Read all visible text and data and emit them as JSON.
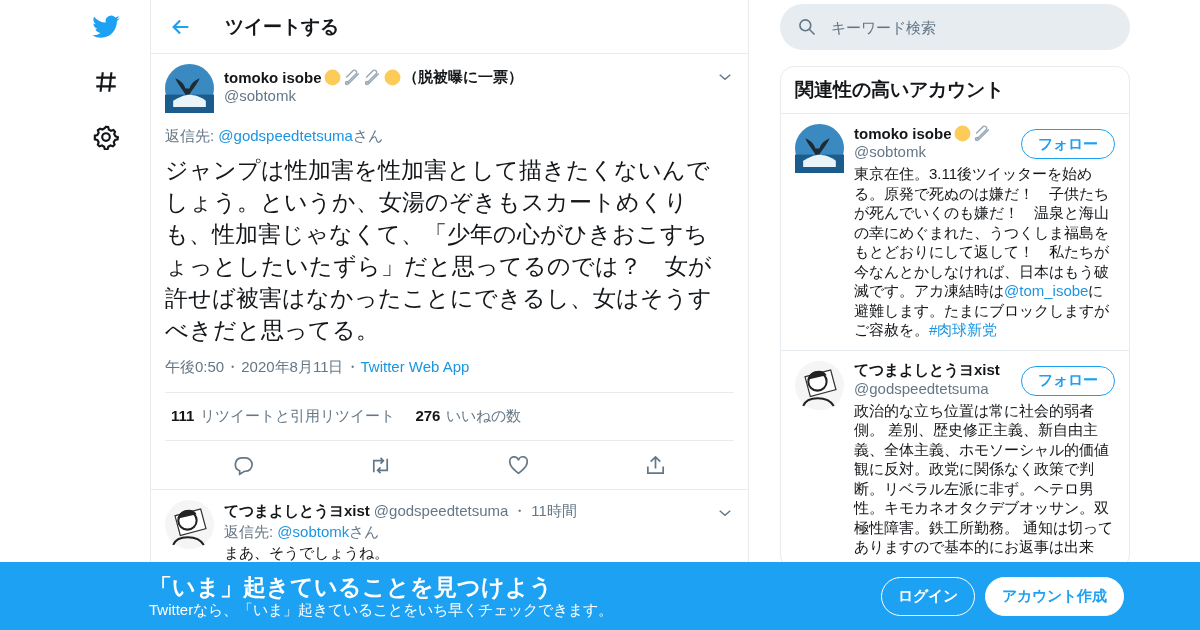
{
  "nav": {
    "items": [
      {
        "kind": "bird"
      },
      {
        "kind": "hash"
      },
      {
        "kind": "gear"
      }
    ]
  },
  "header": {
    "title": "ツイートする"
  },
  "tweet": {
    "name": "tomoko isobe",
    "badges": [
      {
        "kind": "circle"
      },
      {
        "kind": "pin"
      },
      {
        "kind": "pin"
      },
      {
        "kind": "circle"
      }
    ],
    "name_suffix": "（脱被曝に一票）",
    "handle": "@sobtomk",
    "reply_label": "返信先: ",
    "reply_to": "@godspeedtetsuma",
    "reply_suffix": "さん",
    "text": "ジャンプは性加害を性加害として描きたくないんでしょう。というか、女湯のぞきもスカートめくりも、性加害じゃなくて、「少年の心がひきおこすちょっとしたいたずら」だと思ってるのでは？　女が許せば被害はなかったことにできるし、女はそうすべきだと思ってる。",
    "time": "午後0:50",
    "sep1": "・",
    "date": "2020年8月11日",
    "sep2": "・",
    "source": "Twitter Web App",
    "stats": [
      {
        "count": "111",
        "label": "リツイートと引用リツイート"
      },
      {
        "count": "276",
        "label": "いいねの数"
      }
    ],
    "actions": [
      {
        "kind": "reply"
      },
      {
        "kind": "retweet"
      },
      {
        "kind": "like"
      },
      {
        "kind": "share"
      }
    ]
  },
  "replies": [
    {
      "name": "てつまよしとうヨxist",
      "handle": "@godspeedtetsuma",
      "sep": "・",
      "age": "11時間",
      "reply_label": "返信先: ",
      "reply_to": "@sobtomk",
      "reply_suffix": "さん",
      "text": "まあ、そうでしょうね。"
    }
  ],
  "search": {
    "placeholder": "キーワード検索"
  },
  "related": {
    "title": "関連性の高いアカウント",
    "accounts": [
      {
        "name": "tomoko isobe",
        "badges": [
          {
            "kind": "circle"
          },
          {
            "kind": "pin"
          }
        ],
        "handle": "@sobtomk",
        "follow": "フォロー",
        "bio": [
          {
            "kind": "text",
            "t": "東京在住。3.11後ツイッターを始める。原発で死ぬのは嫌だ！　子供たちが死んでいくのも嫌だ！　温泉と海山の幸にめぐまれた、うつくしま福島をもとどおりにして返して！　私たちが今なんとかしなければ、日本はもう破滅です。アカ凍結時は"
          },
          {
            "kind": "mention",
            "t": "@tom_isobe"
          },
          {
            "kind": "text",
            "t": "に避難します。たまにブロックしますがご容赦を。"
          },
          {
            "kind": "hashtag",
            "t": "#肉球新党"
          }
        ]
      },
      {
        "name": "てつまよしとうヨxist",
        "handle": "@godspeedtetsuma",
        "follow": "フォロー",
        "bio": [
          {
            "kind": "text",
            "t": "政治的な立ち位置は常に社会的弱者側。 差別、歴史修正主義、新自由主義、全体主義、ホモソーシャル的価値観に反対。政党に関係なく政策で判断。リベラル左派に非ず。ヘテロ男性。キモカネオタクデブオッサン。双極性障害。鉄工所勤務。 通知は切ってありますので基本的にお返事は出来"
          }
        ]
      }
    ]
  },
  "banner": {
    "title": "「いま」起きていることを見つけよう",
    "subtitle": "Twitterなら、「いま」起きていることをいち早くチェックできます。",
    "buttons": [
      {
        "kind": "outline",
        "label": "ログイン"
      },
      {
        "kind": "solid",
        "label": "アカウント作成"
      }
    ]
  }
}
